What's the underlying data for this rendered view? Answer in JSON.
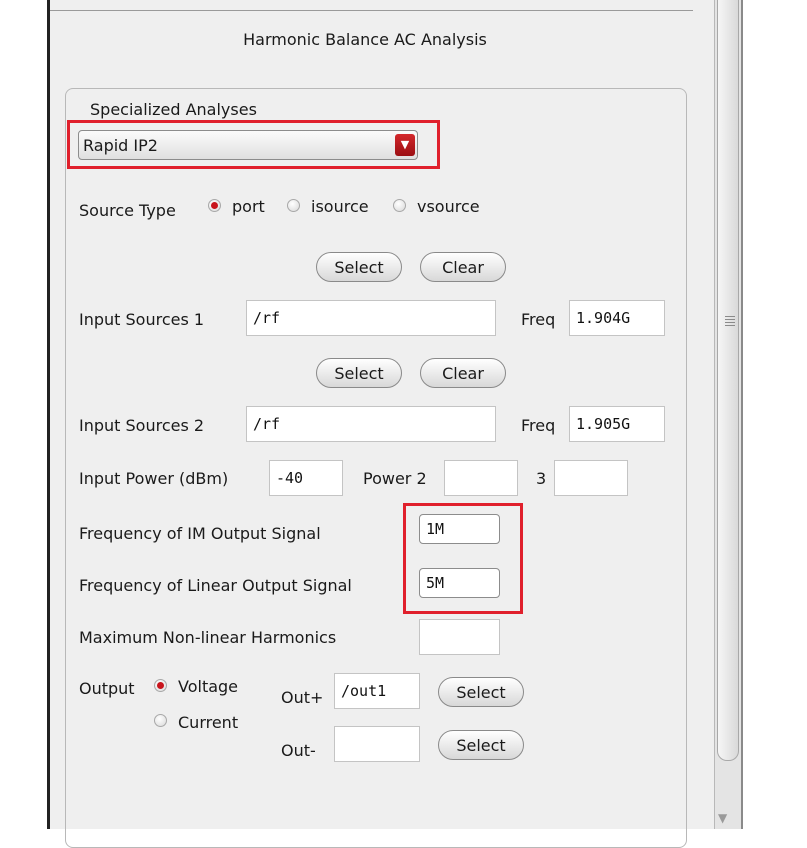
{
  "dialog": {
    "title": "Harmonic Balance AC Analysis"
  },
  "specialized_analyses": {
    "label": "Specialized Analyses",
    "selected": "Rapid IP2"
  },
  "source_type": {
    "label": "Source Type",
    "options": [
      "port",
      "isource",
      "vsource"
    ],
    "selected": "port"
  },
  "buttons": {
    "select": "Select",
    "clear": "Clear"
  },
  "input_sources_1": {
    "label": "Input Sources 1",
    "value": "/rf",
    "freq_label": "Freq",
    "freq": "1.904G"
  },
  "input_sources_2": {
    "label": "Input Sources 2",
    "value": "/rf",
    "freq_label": "Freq",
    "freq": "1.905G"
  },
  "input_power": {
    "label": "Input Power (dBm)",
    "value": "-40",
    "power2_label": "Power 2",
    "power2": "",
    "power3_label": "3",
    "power3": ""
  },
  "im_output_freq": {
    "label": "Frequency of IM Output Signal",
    "value": "1M"
  },
  "linear_output_freq": {
    "label": "Frequency of Linear Output Signal",
    "value": "5M"
  },
  "max_nonlinear_harmonics": {
    "label": "Maximum Non-linear Harmonics",
    "value": ""
  },
  "output": {
    "label": "Output",
    "options": [
      "Voltage",
      "Current"
    ],
    "selected": "Voltage",
    "out_plus_label": "Out+",
    "out_plus": "/out1",
    "out_minus_label": "Out-",
    "out_minus": ""
  },
  "highlight_color": "#e0202c",
  "accent_color": "#c8141c"
}
